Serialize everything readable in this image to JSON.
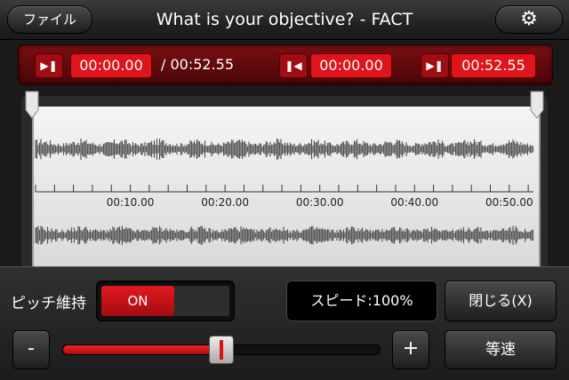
{
  "header": {
    "file_label": "ファイル",
    "title": "What is your objective? - FACT",
    "settings_icon": "gear-icon"
  },
  "timebar": {
    "current_time": "00:00.00",
    "total_time": "/ 00:52.55",
    "loop_start": "00:00.00",
    "loop_end": "00:52.55",
    "play_icon": "play-pause-icon",
    "start_icon": "skip-to-start-icon",
    "end_icon": "skip-to-end-icon"
  },
  "waveform": {
    "ticks": [
      "00:10.00",
      "00:20.00",
      "00:30.00",
      "00:40.00",
      "00:50.00"
    ],
    "duration_seconds": 52.55
  },
  "controls": {
    "pitch_label": "ピッチ維持",
    "pitch_toggle": "ON",
    "speed_display": "スピード:100%",
    "close_label": "閉じる(X)",
    "minus_label": "-",
    "plus_label": "+",
    "normal_speed_label": "等速",
    "speed_slider_fraction": 0.5
  },
  "colors": {
    "accent_red": "#e0141b",
    "dark_red": "#6a0a0d",
    "wave_gray": "#555555"
  }
}
